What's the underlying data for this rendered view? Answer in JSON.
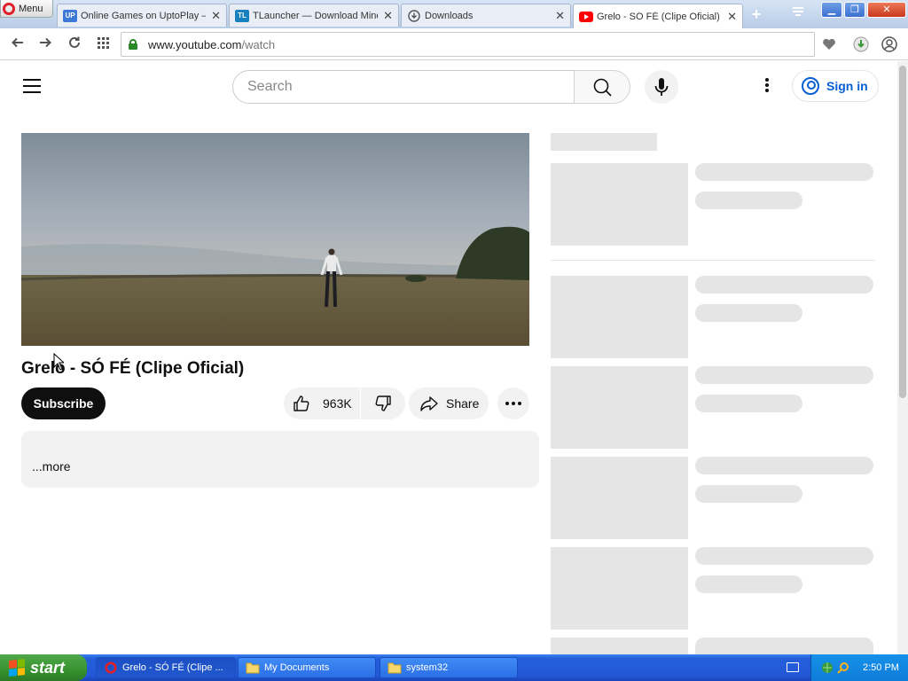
{
  "browser": {
    "menu_label": "Menu",
    "tabs": [
      {
        "title": "Online Games on UptoPlay —",
        "favicon": "uptoplay-icon",
        "active": false
      },
      {
        "title": "TLauncher — Download Mine",
        "favicon": "tlauncher-icon",
        "active": false
      },
      {
        "title": "Downloads",
        "favicon": "download-icon",
        "active": false
      },
      {
        "title": "Grelo - SÓ FÉ (Clipe Oficial) -",
        "favicon": "youtube-icon",
        "active": true
      }
    ],
    "url_host": "www.youtube.com",
    "url_path": "/watch"
  },
  "youtube": {
    "search_placeholder": "Search",
    "signin_label": "Sign in",
    "video_title": "Grelo - SÓ FÉ (Clipe Oficial)",
    "subscribe_label": "Subscribe",
    "like_count": "963K",
    "share_label": "Share",
    "more_label": "...more"
  },
  "taskbar": {
    "start_label": "start",
    "tasks": [
      {
        "label": "Grelo - SÓ FÉ (Clipe ...",
        "icon": "opera-icon",
        "active": true
      },
      {
        "label": "My Documents",
        "icon": "folder-icon",
        "active": false
      },
      {
        "label": "system32",
        "icon": "folder-icon",
        "active": false
      }
    ],
    "clock": "2:50 PM"
  },
  "colors": {
    "youtube_red": "#ff0000",
    "link_blue": "#065fd4",
    "skeleton": "#e5e5e5",
    "xp_taskbar": "#245edb",
    "xp_start_green": "#37922f"
  }
}
